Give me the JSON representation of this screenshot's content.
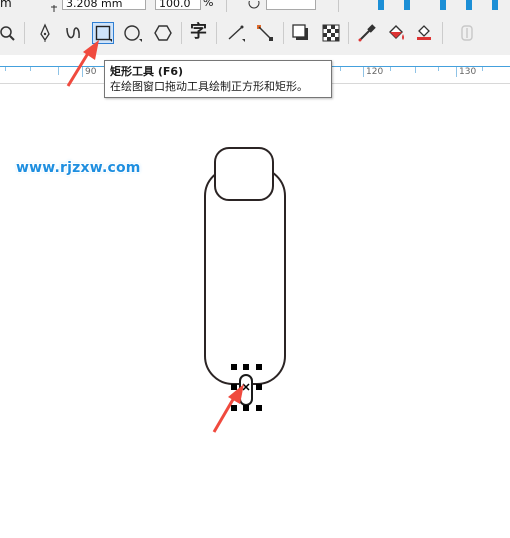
{
  "topbar": {
    "unit_fragment": "m",
    "height_value": "3.208 mm",
    "scale_value": "100.0",
    "percent_sign": "%"
  },
  "toolbar": {
    "tools": [
      {
        "name": "zoom-tool",
        "icon": "magnifier-icon"
      },
      {
        "name": "pen-tool",
        "icon": "pen-nib-icon"
      },
      {
        "name": "artistic-media-tool",
        "icon": "curve-stroke-icon"
      },
      {
        "name": "rectangle-tool",
        "icon": "rectangle-icon",
        "active": true
      },
      {
        "name": "ellipse-tool",
        "icon": "ellipse-icon"
      },
      {
        "name": "polygon-tool",
        "icon": "hexagon-icon"
      },
      {
        "name": "text-tool",
        "icon": "text-glyph-icon",
        "glyph": "字"
      },
      {
        "name": "connector-tool",
        "icon": "connector-line-icon"
      },
      {
        "name": "dimension-tool",
        "icon": "dimension-line-icon"
      },
      {
        "name": "drop-shadow-tool",
        "icon": "drop-shadow-icon"
      },
      {
        "name": "transparency-tool",
        "icon": "checkerboard-icon"
      },
      {
        "name": "eyedropper-tool",
        "icon": "eyedropper-icon"
      },
      {
        "name": "fill-tool",
        "icon": "paint-bucket-icon"
      },
      {
        "name": "smart-fill-tool",
        "icon": "smart-fill-icon"
      },
      {
        "name": "disabled-tool",
        "icon": "disabled-tool-icon"
      }
    ],
    "accent": "#2f7fd3"
  },
  "ruler": {
    "labels": [
      "90",
      "120",
      "130"
    ],
    "color": "#44a0dd"
  },
  "tooltip": {
    "title": "矩形工具 (F6)",
    "description": "在绘图窗口拖动工具绘制正方形和矩形。"
  },
  "watermark": {
    "text": "www.rjzxw.com",
    "color": "#1e8fe0"
  },
  "annotation_color": "#f04a3e"
}
